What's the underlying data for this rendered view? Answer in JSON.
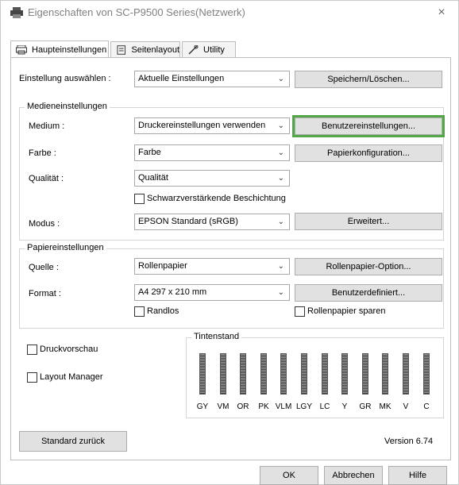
{
  "window": {
    "title": "Eigenschaften von SC-P9500 Series(Netzwerk)",
    "close_label": "×"
  },
  "tabs": [
    {
      "label": "Haupteinstellungen",
      "icon": "printer-icon"
    },
    {
      "label": "Seitenlayout",
      "icon": "page-layout-icon"
    },
    {
      "label": "Utility",
      "icon": "utility-icon"
    }
  ],
  "settings_select": {
    "label": "Einstellung auswählen :",
    "value": "Aktuelle Einstellungen",
    "save_button": "Speichern/Löschen..."
  },
  "media": {
    "group_title": "Medieneinstellungen",
    "medium_label": "Medium :",
    "medium_value": "Druckereinstellungen verwenden",
    "custom_button": "Benutzereinstellungen...",
    "color_label": "Farbe :",
    "color_value": "Farbe",
    "paper_config_button": "Papierkonfiguration...",
    "quality_label": "Qualität :",
    "quality_value": "Qualität",
    "black_enhance_label": "Schwarzverstärkende Beschichtung",
    "mode_label": "Modus :",
    "mode_value": "EPSON Standard (sRGB)",
    "advanced_button": "Erweitert..."
  },
  "paper": {
    "group_title": "Papiereinstellungen",
    "source_label": "Quelle :",
    "source_value": "Rollenpapier",
    "roll_option_button": "Rollenpapier-Option...",
    "format_label": "Format :",
    "format_value": "A4 297 x 210 mm",
    "user_defined_button": "Benutzerdefiniert...",
    "borderless_label": "Randlos",
    "roll_saver_label": "Rollenpapier sparen"
  },
  "preview_label": "Druckvorschau",
  "layout_manager_label": "Layout Manager",
  "ink": {
    "title": "Tintenstand",
    "cartridges": [
      "GY",
      "VM",
      "OR",
      "PK",
      "VLM",
      "LGY",
      "LC",
      "Y",
      "GR",
      "MK",
      "V",
      "C"
    ]
  },
  "reset_button": "Standard zurück",
  "version": "Version 6.74",
  "footer": {
    "ok": "OK",
    "cancel": "Abbrechen",
    "help": "Hilfe"
  },
  "colors": {
    "highlight": "#54a748",
    "button_bg": "#e1e1e1"
  }
}
